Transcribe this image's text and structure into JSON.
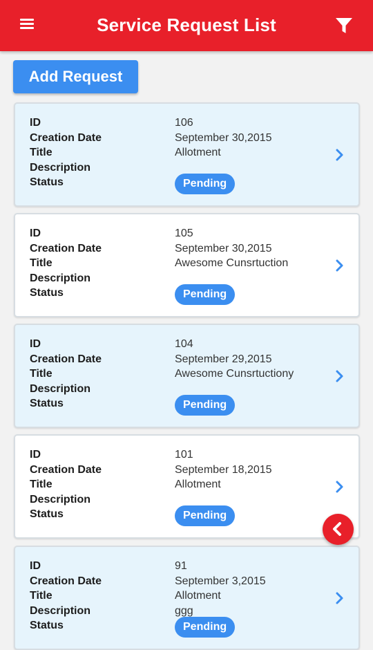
{
  "app_bar": {
    "title": "Service Request List",
    "menu_icon": "hamburger-menu-icon",
    "filter_icon": "filter-funnel-icon"
  },
  "add_button": {
    "label": "Add Request"
  },
  "field_labels": {
    "id": "ID",
    "creation_date": "Creation Date",
    "title": "Title",
    "description": "Description",
    "status": "Status"
  },
  "requests": [
    {
      "id": "106",
      "creation_date": "September 30,2015",
      "title": "Allotment",
      "description": "",
      "status": "Pending"
    },
    {
      "id": "105",
      "creation_date": "September 30,2015",
      "title": "Awesome Cunsrtuction",
      "description": "",
      "status": "Pending"
    },
    {
      "id": "104",
      "creation_date": "September 29,2015",
      "title": "Awesome Cunsrtuctiony",
      "description": "",
      "status": "Pending"
    },
    {
      "id": "101",
      "creation_date": "September 18,2015",
      "title": "Allotment",
      "description": "",
      "status": "Pending"
    },
    {
      "id": "91",
      "creation_date": "September 3,2015",
      "title": "Allotment",
      "description": "ggg",
      "status": "Pending"
    }
  ],
  "colors": {
    "app_bar": "#e8202a",
    "accent": "#3b8ef0",
    "card_highlight": "#e6f4fc",
    "card_plain": "#ffffff"
  },
  "fab_icon": "chevron-left-icon"
}
